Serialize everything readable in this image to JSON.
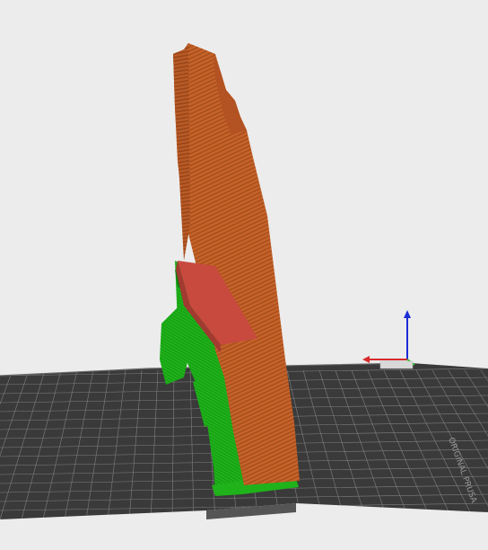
{
  "scene": {
    "background_color": "#ececec",
    "bed_color": "#3a3a3a",
    "bed_grid_color": "#8d8d8d",
    "model_color": "#c6632a",
    "model_stripe_color": "#a44d1b",
    "model_top_color": "#c84a3f",
    "support_color": "#1fb21a",
    "support_dark_color": "#0d7a10",
    "axis_x_color": "#d92b2b",
    "axis_y_color": "#2fbf2f",
    "axis_z_color": "#1b2bd6",
    "bed_logo_text": "ORIGINAL PRUSA"
  }
}
